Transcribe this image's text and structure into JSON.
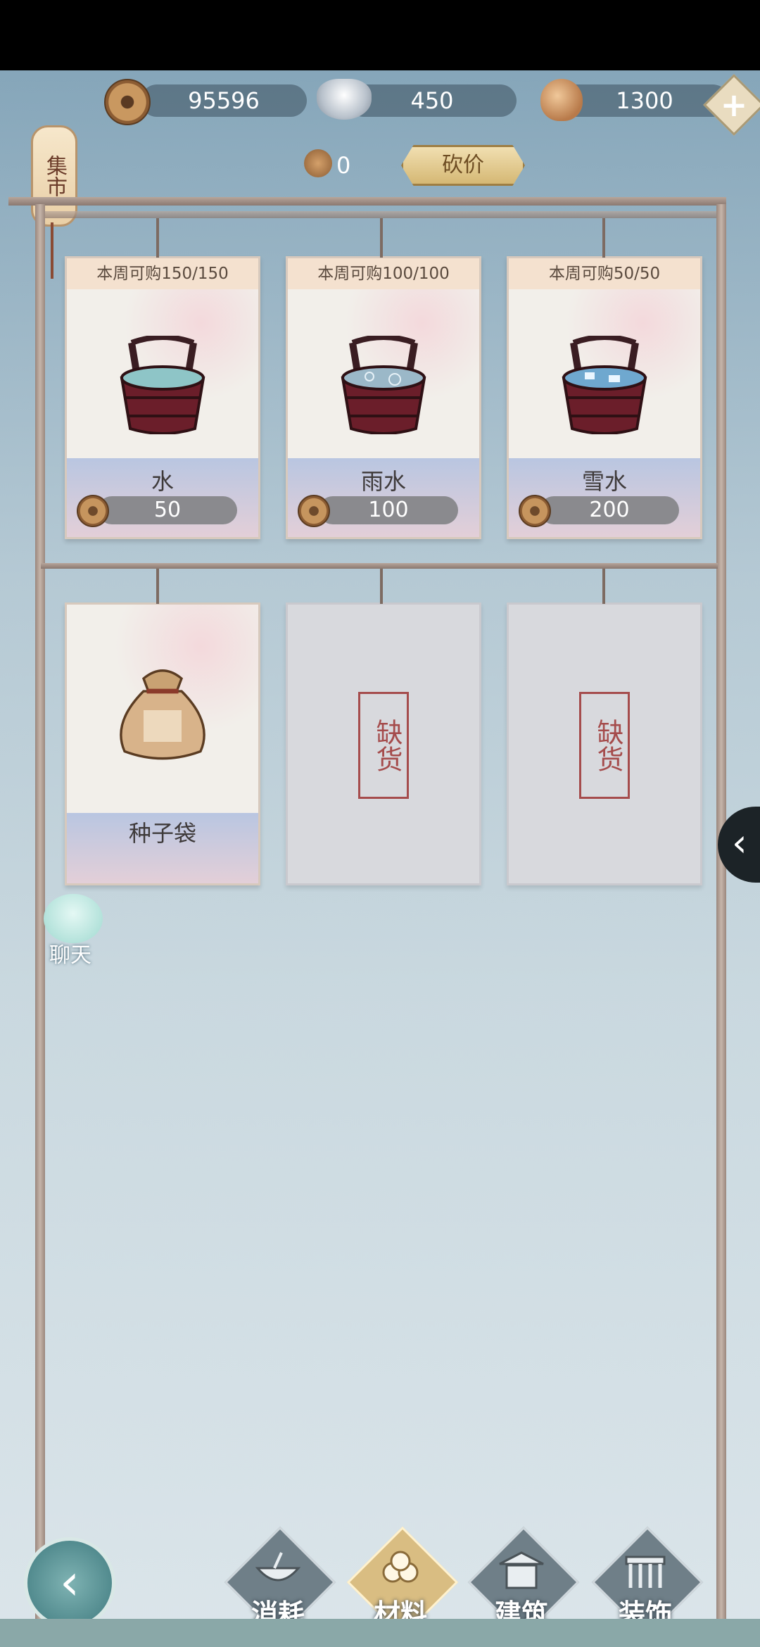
{
  "currency": {
    "copper": "95596",
    "silver": "450",
    "shell": "1300"
  },
  "market_label": "集市",
  "bargain": {
    "token_count": "0",
    "button_label": "砍价"
  },
  "shelf_row1": [
    {
      "limit": "本周可购150/150",
      "name": "水",
      "price": "50",
      "icon": "water-bucket-icon"
    },
    {
      "limit": "本周可购100/100",
      "name": "雨水",
      "price": "100",
      "icon": "rain-water-bucket-icon"
    },
    {
      "limit": "本周可购50/50",
      "name": "雪水",
      "price": "200",
      "icon": "snow-water-bucket-icon"
    }
  ],
  "shelf_row2": [
    {
      "name": "种子袋",
      "icon": "seed-bag-icon"
    },
    {
      "status": "缺货"
    },
    {
      "status": "缺货"
    }
  ],
  "chat_label": "聊天",
  "tabs": [
    {
      "label": "消耗",
      "icon": "bowl-icon",
      "active": false
    },
    {
      "label": "材料",
      "icon": "materials-icon",
      "active": true
    },
    {
      "label": "建筑",
      "icon": "building-icon",
      "active": false
    },
    {
      "label": "装饰",
      "icon": "decoration-icon",
      "active": false
    }
  ],
  "colors": {
    "accent": "#d9bd82",
    "soldout": "#a54c4c",
    "pill": "#8a8a8e"
  }
}
